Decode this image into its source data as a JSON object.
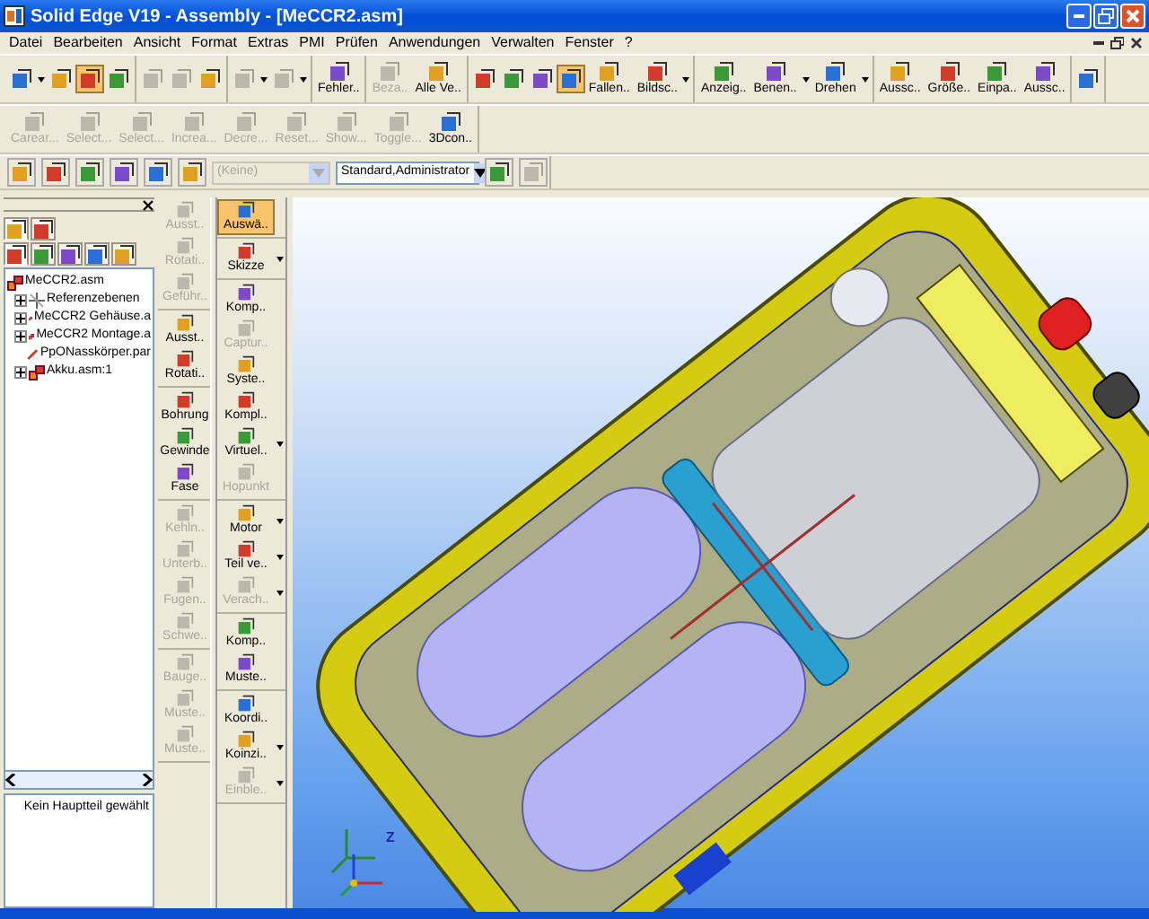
{
  "window": {
    "title": "Solid Edge V19 - Assembly - [MeCCR2.asm]"
  },
  "menu": [
    "Datei",
    "Bearbeiten",
    "Ansicht",
    "Format",
    "Extras",
    "PMI",
    "Prüfen",
    "Anwendungen",
    "Verwalten",
    "Fenster",
    "?"
  ],
  "toolbar_main": [
    [
      {
        "kind": "icon",
        "disabled": false,
        "selected": false,
        "dropdown": true
      },
      {
        "kind": "icon",
        "disabled": false,
        "selected": false
      },
      {
        "kind": "icon",
        "disabled": false,
        "selected": true
      },
      {
        "kind": "icon",
        "disabled": false,
        "selected": false
      }
    ],
    [
      {
        "kind": "icon",
        "disabled": true,
        "selected": false
      },
      {
        "kind": "icon",
        "disabled": true,
        "selected": false
      },
      {
        "kind": "icon",
        "disabled": false,
        "selected": false
      }
    ],
    [
      {
        "kind": "icon",
        "disabled": true,
        "selected": false,
        "dropdown": true
      },
      {
        "kind": "icon",
        "disabled": true,
        "selected": false,
        "dropdown": true
      }
    ],
    [
      {
        "kind": "labeled",
        "label": "Fehler..",
        "disabled": false,
        "selected": false
      }
    ],
    [
      {
        "kind": "labeled",
        "label": "Beza..",
        "disabled": true,
        "selected": false
      },
      {
        "kind": "labeled",
        "label": "Alle Ve..",
        "disabled": false,
        "selected": false
      }
    ],
    [
      {
        "kind": "icon",
        "disabled": false,
        "selected": false
      },
      {
        "kind": "icon",
        "disabled": false,
        "selected": false
      },
      {
        "kind": "icon",
        "disabled": false,
        "selected": false
      },
      {
        "kind": "icon",
        "disabled": false,
        "selected": true
      },
      {
        "kind": "labeled",
        "label": "Fallen..",
        "disabled": false,
        "selected": false
      },
      {
        "kind": "labeled",
        "label": "Bildsc..",
        "disabled": false,
        "selected": false,
        "dropdown": true
      }
    ],
    [
      {
        "kind": "labeled",
        "label": "Anzeig..",
        "disabled": false,
        "selected": false
      },
      {
        "kind": "labeled",
        "label": "Benen..",
        "disabled": false,
        "selected": false,
        "dropdown": true
      },
      {
        "kind": "labeled",
        "label": "Drehen",
        "disabled": false,
        "selected": false,
        "dropdown": true
      }
    ],
    [
      {
        "kind": "labeled",
        "label": "Aussc..",
        "disabled": false,
        "selected": false
      },
      {
        "kind": "labeled",
        "label": "Größe..",
        "disabled": false,
        "selected": false
      },
      {
        "kind": "labeled",
        "label": "Einpa..",
        "disabled": false,
        "selected": false
      },
      {
        "kind": "labeled",
        "label": "Aussc..",
        "disabled": false,
        "selected": false
      }
    ],
    [
      {
        "kind": "icon",
        "disabled": false,
        "selected": false
      }
    ]
  ],
  "toolbar_3d": [
    {
      "label": "Carear...",
      "disabled": true
    },
    {
      "label": "Select...",
      "disabled": true
    },
    {
      "label": "Select...",
      "disabled": true
    },
    {
      "label": "Increa...",
      "disabled": true
    },
    {
      "label": "Decre...",
      "disabled": true
    },
    {
      "label": "Reset...",
      "disabled": true
    },
    {
      "label": "Show...",
      "disabled": true
    },
    {
      "label": "Toggle...",
      "disabled": true
    },
    {
      "label": "3Dcon..",
      "disabled": false
    }
  ],
  "toolbar_format": {
    "icons": [
      {
        "disabled": false
      },
      {
        "disabled": false
      },
      {
        "disabled": false
      },
      {
        "disabled": false
      },
      {
        "disabled": false
      },
      {
        "disabled": false
      }
    ],
    "layer_combo": {
      "value": "(Keine)",
      "disabled": true
    },
    "style_combo": {
      "value": "Standard,Administrator",
      "disabled": false
    },
    "tail_icons": [
      {
        "disabled": false
      },
      {
        "disabled": true
      }
    ]
  },
  "pathfinder": {
    "top_tabs": [
      {
        "selected": true
      },
      {
        "selected": false
      }
    ],
    "tabs": [
      {
        "selected": true
      },
      {
        "selected": false
      },
      {
        "selected": false
      },
      {
        "selected": false
      },
      {
        "selected": false
      }
    ],
    "tree": [
      {
        "kind": "assembly",
        "label": "MeCCR2.asm",
        "children": [
          {
            "kind": "planes",
            "label": "Referenzebenen"
          },
          {
            "kind": "assembly",
            "label": "MeCCR2 Gehäuse.a"
          },
          {
            "kind": "assembly",
            "label": "MeCCR2 Montage.a"
          },
          {
            "kind": "part",
            "label": "PpONasskörper.par"
          },
          {
            "kind": "assembly",
            "label": "Akku.asm:1"
          }
        ]
      }
    ],
    "status": "Kein Hauptteil gewählt"
  },
  "feature_bar": [
    [
      {
        "label": "Ausst..",
        "disabled": true
      },
      {
        "label": "Rotati..",
        "disabled": true
      },
      {
        "label": "Geführ..",
        "disabled": true
      }
    ],
    [
      {
        "label": "Ausst..",
        "disabled": false
      },
      {
        "label": "Rotati..",
        "disabled": false
      }
    ],
    [
      {
        "label": "Bohrung",
        "disabled": false
      },
      {
        "label": "Gewinde",
        "disabled": false
      },
      {
        "label": "Fase",
        "disabled": false
      }
    ],
    [
      {
        "label": "Kehln..",
        "disabled": true
      },
      {
        "label": "Unterb..",
        "disabled": true
      },
      {
        "label": "Fugen..",
        "disabled": true
      },
      {
        "label": "Schwe..",
        "disabled": true
      }
    ],
    [
      {
        "label": "Bauge..",
        "disabled": true
      },
      {
        "label": "Muste..",
        "disabled": true
      },
      {
        "label": "Muste..",
        "disabled": true
      }
    ]
  ],
  "assembly_bar": [
    [
      {
        "label": "Auswä..",
        "disabled": false,
        "selected": true
      }
    ],
    [
      {
        "label": "Skizze",
        "disabled": false,
        "selected": false,
        "dropdown": true
      }
    ],
    [
      {
        "label": "Komp..",
        "disabled": false,
        "selected": false
      },
      {
        "label": "Captur..",
        "disabled": true,
        "selected": false
      },
      {
        "label": "Syste..",
        "disabled": false,
        "selected": false
      },
      {
        "label": "Kompl..",
        "disabled": false,
        "selected": false
      },
      {
        "label": "Virtuel..",
        "disabled": false,
        "selected": false,
        "dropdown": true
      },
      {
        "label": "Hopunkt",
        "disabled": true,
        "selected": false
      }
    ],
    [
      {
        "label": "Motor",
        "disabled": false,
        "selected": false,
        "dropdown": true
      },
      {
        "label": "Teil ve..",
        "disabled": false,
        "selected": false,
        "dropdown": true
      },
      {
        "label": "Verach..",
        "disabled": true,
        "selected": false,
        "dropdown": true
      }
    ],
    [
      {
        "label": "Komp..",
        "disabled": false,
        "selected": false
      },
      {
        "label": "Muste..",
        "disabled": false,
        "selected": false
      }
    ],
    [
      {
        "label": "Koordi..",
        "disabled": false,
        "selected": false
      },
      {
        "label": "Koinzi..",
        "disabled": false,
        "selected": false,
        "dropdown": true
      },
      {
        "label": "Einble..",
        "disabled": true,
        "selected": false,
        "dropdown": true
      }
    ]
  ],
  "viewport": {
    "axis_label": "Z"
  }
}
